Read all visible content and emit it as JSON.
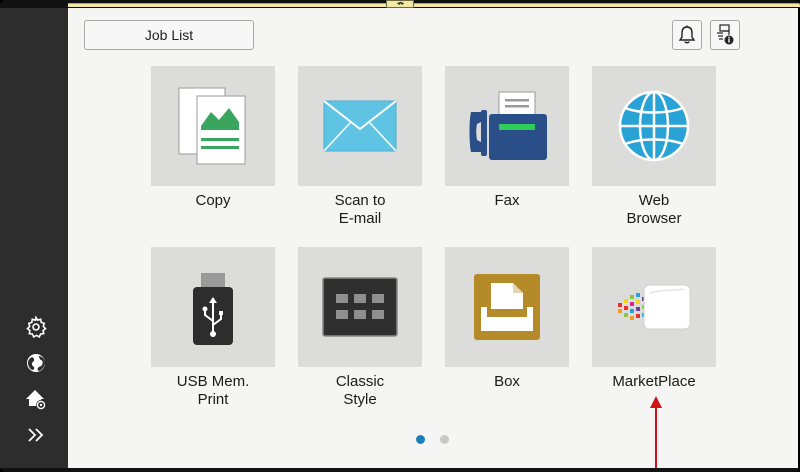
{
  "header": {
    "job_list_label": "Job List"
  },
  "top_icons": [
    "bell-icon",
    "device-info-icon"
  ],
  "sidebar": {
    "icons": [
      "settings-gear-icon",
      "globe-language-icon",
      "home-settings-icon",
      "expand-chevrons-icon"
    ]
  },
  "apps": [
    {
      "line1": "Copy",
      "line2": "",
      "icon": "copy-icon"
    },
    {
      "line1": "Scan to",
      "line2": "E-mail",
      "icon": "envelope-icon"
    },
    {
      "line1": "Fax",
      "line2": "",
      "icon": "fax-icon"
    },
    {
      "line1": "Web",
      "line2": "Browser",
      "icon": "globe-icon"
    },
    {
      "line1": "USB Mem.",
      "line2": "Print",
      "icon": "usb-icon"
    },
    {
      "line1": "Classic",
      "line2": "Style",
      "icon": "keypad-icon"
    },
    {
      "line1": "Box",
      "line2": "",
      "icon": "box-icon"
    },
    {
      "line1": "MarketPlace",
      "line2": "",
      "icon": "marketplace-icon"
    }
  ],
  "pagination": {
    "total": 2,
    "current": 1
  },
  "colors": {
    "active_dot": "#1a7fb8",
    "inactive_dot": "#c8c8c8",
    "arrow": "#d0121b",
    "sidebar": "#2d2d2d",
    "tile": "#dcdcdb"
  }
}
